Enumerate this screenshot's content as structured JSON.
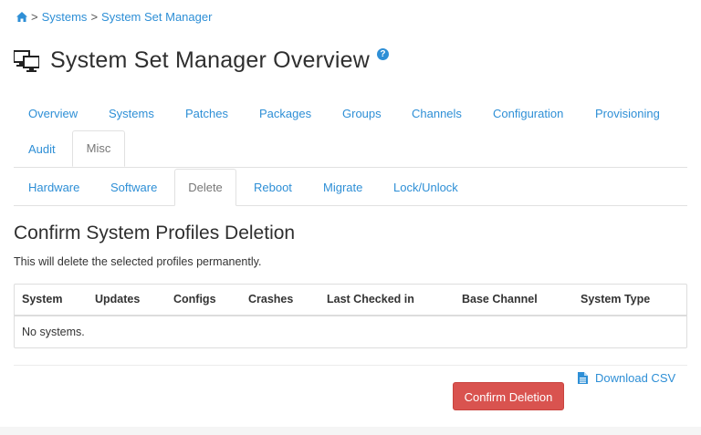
{
  "breadcrumb": {
    "items": [
      "Systems",
      "System Set Manager"
    ],
    "separator": ">"
  },
  "page": {
    "title": "System Set Manager Overview",
    "help": "?"
  },
  "tabs_primary": [
    "Overview",
    "Systems",
    "Patches",
    "Packages",
    "Groups",
    "Channels",
    "Configuration",
    "Provisioning",
    "Audit",
    "Misc"
  ],
  "tabs_primary_active": "Misc",
  "tabs_secondary": [
    "Hardware",
    "Software",
    "Delete",
    "Reboot",
    "Migrate",
    "Lock/Unlock"
  ],
  "tabs_secondary_active": "Delete",
  "section": {
    "title": "Confirm System Profiles Deletion",
    "description": "This will delete the selected profiles permanently."
  },
  "table": {
    "columns": [
      "System",
      "Updates",
      "Configs",
      "Crashes",
      "Last Checked in",
      "Base Channel",
      "System Type"
    ],
    "empty_message": "No systems."
  },
  "actions": {
    "download_csv": "Download CSV",
    "confirm": "Confirm Deletion"
  },
  "colors": {
    "link": "#2e8fd6",
    "danger": "#d9534f",
    "border": "#dddddd"
  }
}
